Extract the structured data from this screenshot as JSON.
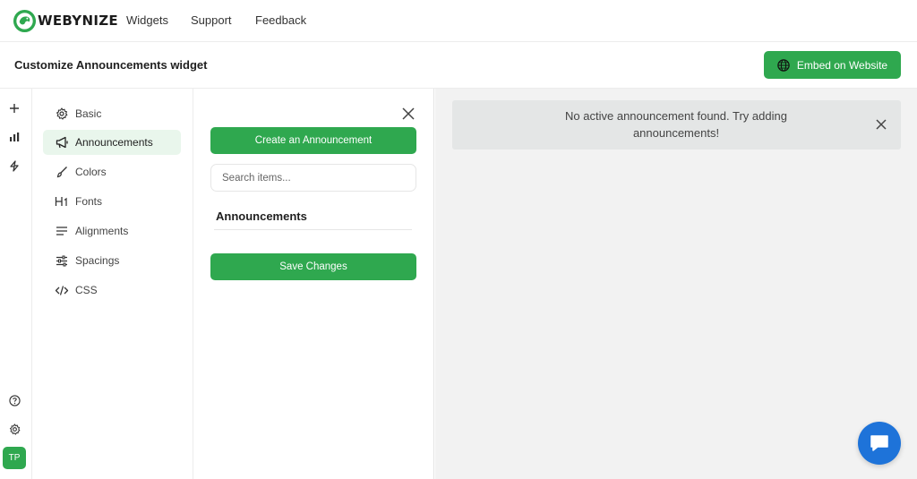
{
  "brand": {
    "name": "WEBYNIZE",
    "accent": "#2fa84f"
  },
  "nav": {
    "links": [
      "Widgets",
      "Support",
      "Feedback"
    ]
  },
  "header": {
    "title": "Customize Announcements widget",
    "embed_label": "Embed on Website",
    "embed_icon": "globe-icon"
  },
  "rail": {
    "top_icons": [
      "plus-icon",
      "bar-chart-icon",
      "lightning-icon"
    ],
    "bottom_icons": [
      "help-icon",
      "gear-icon"
    ],
    "avatar": "TP"
  },
  "menu": {
    "items": [
      {
        "label": "Basic",
        "icon": "gear-icon"
      },
      {
        "label": "Announcements",
        "icon": "megaphone-icon",
        "active": true
      },
      {
        "label": "Colors",
        "icon": "brush-icon"
      },
      {
        "label": "Fonts",
        "icon": "heading-icon"
      },
      {
        "label": "Alignments",
        "icon": "align-left-icon"
      },
      {
        "label": "Spacings",
        "icon": "sliders-icon"
      },
      {
        "label": "CSS",
        "icon": "code-icon"
      }
    ]
  },
  "panel": {
    "create_label": "Create an Announcement",
    "search_placeholder": "Search items...",
    "list_heading": "Announcements",
    "save_label": "Save Changes"
  },
  "preview": {
    "notice_text": "No active announcement found. Try adding announcements!",
    "chat_icon": "chat-bubble-icon",
    "chat_color": "#1e73d9"
  }
}
